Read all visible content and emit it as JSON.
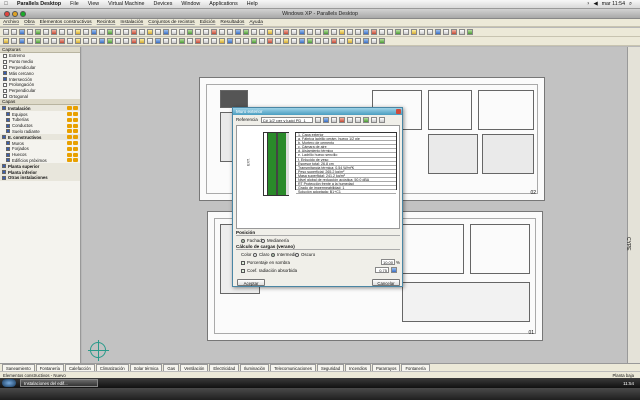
{
  "mac_menu": {
    "app_name": "Parallels Desktop",
    "items": [
      "File",
      "View",
      "Virtual Machine",
      "Devices",
      "Window",
      "Applications",
      "Help"
    ],
    "clock": "mar 11:54"
  },
  "window": {
    "title": "Windows XP - Parallels Desktop"
  },
  "app_menu": [
    "Archivo",
    "Obra",
    "Elementos constructivos",
    "Recintos",
    "Instalación",
    "Conjuntos de recintos",
    "Edición",
    "Resultados",
    "Ayuda"
  ],
  "panel": {
    "capture_header": "Capturas",
    "capture_items": [
      {
        "label": "Extremo",
        "checked": false
      },
      {
        "label": "Punto medio",
        "checked": false
      },
      {
        "label": "Perpendicular",
        "checked": false
      },
      {
        "label": "Más cercano",
        "checked": true
      },
      {
        "label": "Intersección",
        "checked": true
      },
      {
        "label": "Prolongación",
        "checked": false
      },
      {
        "label": "Perpendicular",
        "checked": false
      },
      {
        "label": "Ortogonal",
        "checked": false
      }
    ],
    "layers_header": "Capas",
    "layers": [
      {
        "label": "Instalación",
        "cat": true
      },
      {
        "label": "Equipos",
        "cat": false
      },
      {
        "label": "Tuberías",
        "cat": false
      },
      {
        "label": "Conductos",
        "cat": false
      },
      {
        "label": "Suelo radiante",
        "cat": false
      },
      {
        "label": "E. constructivos",
        "cat": true
      },
      {
        "label": "Muros",
        "cat": false
      },
      {
        "label": "Forjados",
        "cat": false
      },
      {
        "label": "Huecos",
        "cat": false
      },
      {
        "label": "Edificios próximos",
        "cat": false
      },
      {
        "label": "Planta superior",
        "cat": true
      },
      {
        "label": "Planta inferior",
        "cat": true
      },
      {
        "label": "Otras instalaciones",
        "cat": true
      }
    ]
  },
  "canvas": {
    "side_label": "CYPE",
    "plan_numbers": [
      "02",
      "01"
    ]
  },
  "dialog": {
    "title": "Muro exterior",
    "ref_label": "Referencia",
    "ref_value": "C# 1/2' per y lucid PD_1",
    "table_lines": [
      "1. Capa exterior",
      "  a. Fábrica ladrillo cerám. hueco 1/2 pie",
      "  b. Mortero de cemento",
      "  c. Cámara de aire",
      "  d. Aislamiento térmico",
      "  e. Ladrillo hueco sencillo",
      "  f. Enlucido de yeso",
      "Espesor total: 26.8 cm",
      "Transmitancia térmica: 0.54 W/m²K",
      "Peso superficial: 265.2 kg/m²",
      "Masa superficial: 241.2 kg/m²",
      "Nivel global de reducción acústica: 50.0 dBA",
      "RT Protección frente a la humedad",
      "Grado de impermeabilidad: 1",
      "Solución adoptada: B1+C1"
    ],
    "wall_label": "EXT.",
    "pos_header": "Posición",
    "pos_options": [
      {
        "label": "Fachada",
        "on": true
      },
      {
        "label": "Medianería",
        "on": false
      }
    ],
    "load_header": "Cálculo de cargas (verano)",
    "color_label": "Color",
    "color_options": [
      {
        "label": "Claro",
        "on": false
      },
      {
        "label": "Intermedio",
        "on": true
      },
      {
        "label": "Oscuro",
        "on": false
      }
    ],
    "shadow_label": "Porcentaje en sombra",
    "shadow_value": "10.00",
    "shadow_unit": "%",
    "coef_label": "Coef. radiación absorbida",
    "coef_value": "0.75",
    "accept": "Aceptar",
    "cancel": "Cancelar"
  },
  "tabs": [
    "Saneamiento",
    "Fontanería",
    "Calefacción",
    "Climatización",
    "Solar térmica",
    "Gas",
    "Ventilación",
    "Electricidad",
    "Iluminación",
    "Telecomunicaciones",
    "Seguridad",
    "Incendios",
    "Pararrayos",
    "Fontanería"
  ],
  "status": {
    "left": "Elementos constructivos - Nuevo",
    "right": "Planta baja"
  },
  "xp_taskbar": {
    "item": "Instalaciones del edif...",
    "clock": "11:54"
  },
  "colors": {
    "dialog_title": "#4a9dc0",
    "wall_green": "#2a8a2a",
    "accent_orange": "#e8a000"
  }
}
